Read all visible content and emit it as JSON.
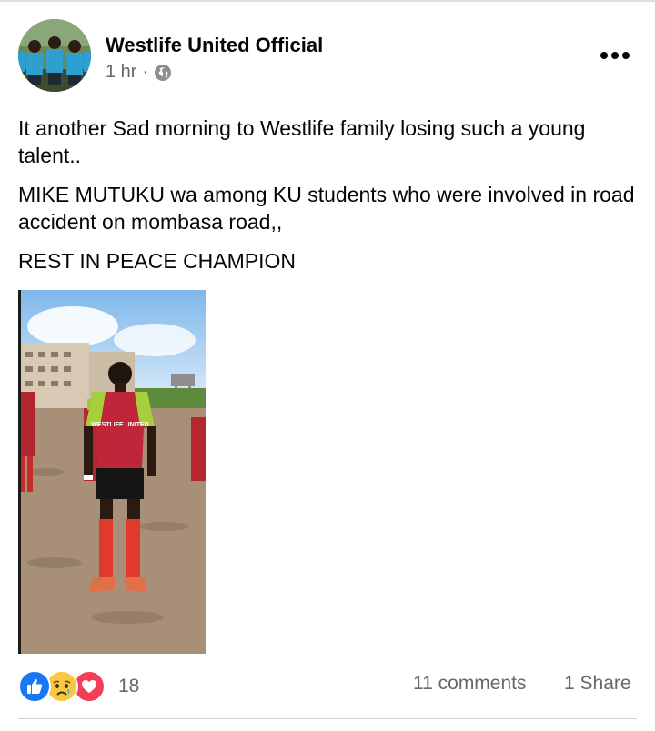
{
  "post": {
    "page_name": "Westlife United Official",
    "time": "1 hr",
    "separator": "·",
    "privacy_icon": "globe-icon",
    "more_icon": "more-options-icon",
    "paragraphs": [
      "It another Sad morning to Westlife family losing such a young talent..",
      "MIKE MUTUKU wa among KU students who were involved in road accident on mombasa road,,",
      "REST IN PEACE CHAMPION"
    ],
    "photo_icon": "player-photo",
    "jersey_text": "WESTLIFE UNITED"
  },
  "engagement": {
    "reaction_icons": [
      "like-icon",
      "sad-icon",
      "love-icon"
    ],
    "reaction_count": "18",
    "comments": "11 comments",
    "shares": "1 Share"
  },
  "colors": {
    "text_primary": "#050505",
    "text_secondary": "#65676b",
    "like_blue": "#1877f2",
    "love_red": "#f33e58",
    "sad_yellow": "#f7c844"
  }
}
